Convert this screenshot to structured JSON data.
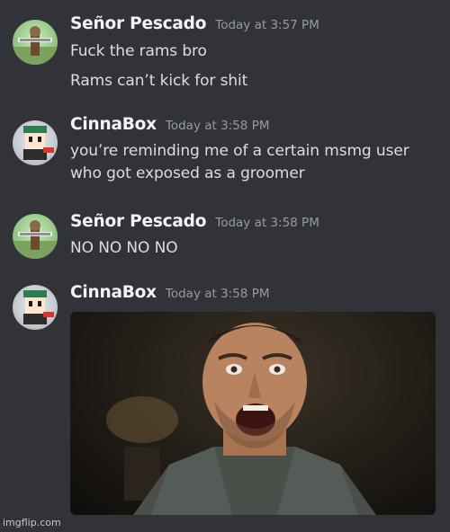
{
  "messages": [
    {
      "username": "Señor Pescado",
      "timestamp": "Today at 3:57 PM",
      "lines": [
        "Fuck the rams bro",
        "Rams can’t kick for shit"
      ]
    },
    {
      "username": "CinnaBox",
      "timestamp": "Today at 3:58 PM",
      "lines": [
        "you’re reminding me of a certain msmg user",
        "who got exposed as a groomer"
      ]
    },
    {
      "username": "Señor Pescado",
      "timestamp": "Today at 3:58 PM",
      "lines": [
        "NO NO NO NO"
      ]
    },
    {
      "username": "CinnaBox",
      "timestamp": "Today at 3:58 PM",
      "attachment": "shocked-man-reaction-image"
    }
  ],
  "watermark": "imgflip.com",
  "colors": {
    "background": "#313338",
    "username": "#f2f3f5",
    "timestamp": "#949ba4",
    "message_text": "#dbdee1"
  }
}
